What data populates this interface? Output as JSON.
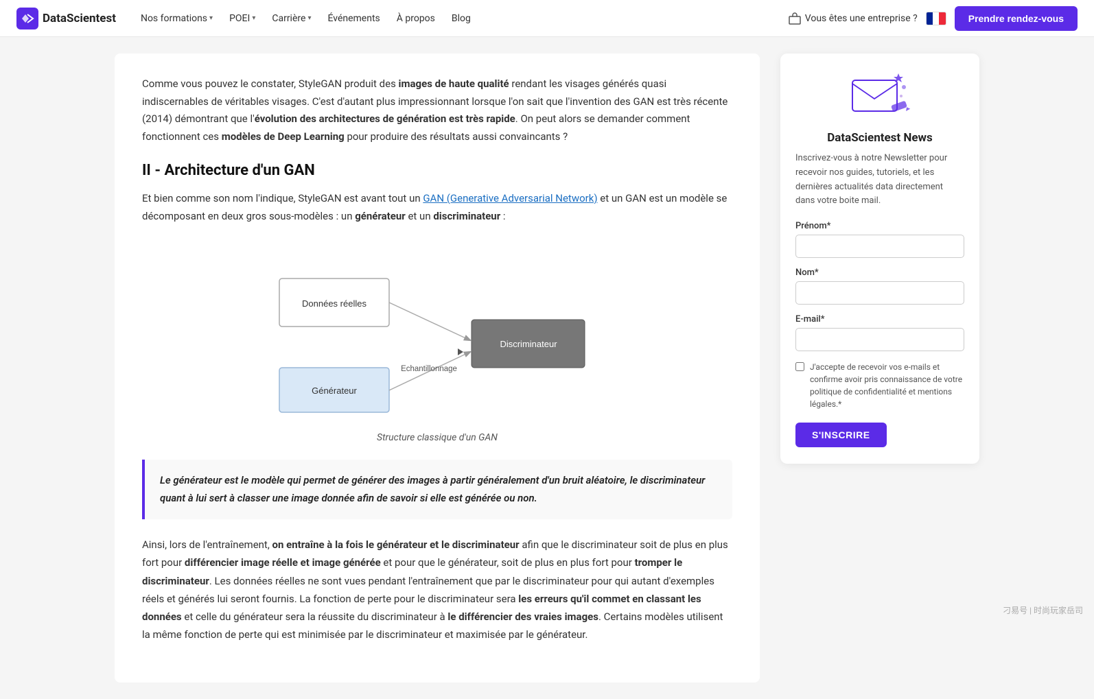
{
  "navbar": {
    "logo_text": "DataScientest",
    "nav_items": [
      {
        "label": "Nos formations",
        "has_chevron": true
      },
      {
        "label": "POEI",
        "has_chevron": true
      },
      {
        "label": "Carrière",
        "has_chevron": true
      },
      {
        "label": "Événements",
        "has_chevron": false
      },
      {
        "label": "À propos",
        "has_chevron": false
      },
      {
        "label": "Blog",
        "has_chevron": false
      }
    ],
    "enterprise_label": "Vous êtes une entreprise ?",
    "cta_label": "Prendre rendez-vous"
  },
  "article": {
    "intro_p1_before": "Comme vous pouvez le constater, StyleGAN produit des ",
    "intro_bold1": "images de haute qualité",
    "intro_p1_after": " rendant les visages générés quasi indiscernables de véritables visages. C'est d'autant plus impressionnant lorsque l'on sait que l'invention des GAN est très récente (2014) démontrant que l'",
    "intro_bold2": "évolution des architectures de génération est très rapide",
    "intro_p1_end": ". On peut alors se demander comment fonctionnent ces ",
    "intro_bold3": "modèles de Deep Learning",
    "intro_p1_final": " pour produire des résultats aussi convaincants ?",
    "section2_title": "II - Architecture d'un GAN",
    "section2_intro_before": "Et bien comme son nom l'indique, StyleGAN est avant tout un ",
    "section2_link": "GAN (Generative Adversarial Network)",
    "section2_intro_after": " et un GAN est un modèle se décomposant en deux gros sous-modèles : un ",
    "section2_bold1": "générateur",
    "section2_intro_and": " et un ",
    "section2_bold2": "discriminateur",
    "section2_intro_end": " :",
    "diagram_caption": "Structure classique d'un GAN",
    "diagram": {
      "box_donnees": "Données réelles",
      "box_generateur": "Générateur",
      "box_discriminateur": "Discriminateur",
      "label_echantillonnage": "Echantillonnage"
    },
    "quote": "Le générateur est le modèle qui permet de générer des images à partir généralement d'un bruit aléatoire, le discriminateur quant à lui sert à classer une image donnée afin de savoir si elle est générée ou non.",
    "body1_before": "Ainsi, lors de l'entraînement, ",
    "body1_bold1": "on entraîne à la fois le générateur et le discriminateur",
    "body1_after": " afin que le discriminateur soit de plus en plus fort pour ",
    "body1_bold2": "différencier image réelle et image générée",
    "body1_after2": " et pour que le générateur, soit de plus en plus fort pour ",
    "body1_bold3": "tromper le discriminateur",
    "body1_after3": ". Les données réelles ne sont vues pendant l'entraînement que par le discriminateur pour qui autant d'exemples réels et générés lui seront fournis. La fonction de perte pour le discriminateur sera ",
    "body1_bold4": "les erreurs qu'il commet en classant les données",
    "body1_after4": " et celle du générateur sera la réussite du discriminateur à ",
    "body1_bold5": "le différencier des vraies images",
    "body1_after5": ". Certains modèles utilisent la même fonction de perte qui est minimisée par le discriminateur et maximisée par le générateur."
  },
  "newsletter": {
    "title": "DataScientest News",
    "description": "Inscrivez-vous à notre Newsletter pour recevoir nos guides, tutoriels, et les dernières actualités data directement dans votre boite mail.",
    "prenom_label": "Prénom*",
    "nom_label": "Nom*",
    "email_label": "E-mail*",
    "prenom_placeholder": "",
    "nom_placeholder": "",
    "email_placeholder": "",
    "checkbox_label": "J'accepte de recevoir vos e-mails et confirme avoir pris connaissance de votre politique de confidentialité et mentions légales.*",
    "subscribe_button": "S'INSCRIRE"
  },
  "watermark": {
    "text": "刁易号 | 时尚玩家岳司"
  }
}
